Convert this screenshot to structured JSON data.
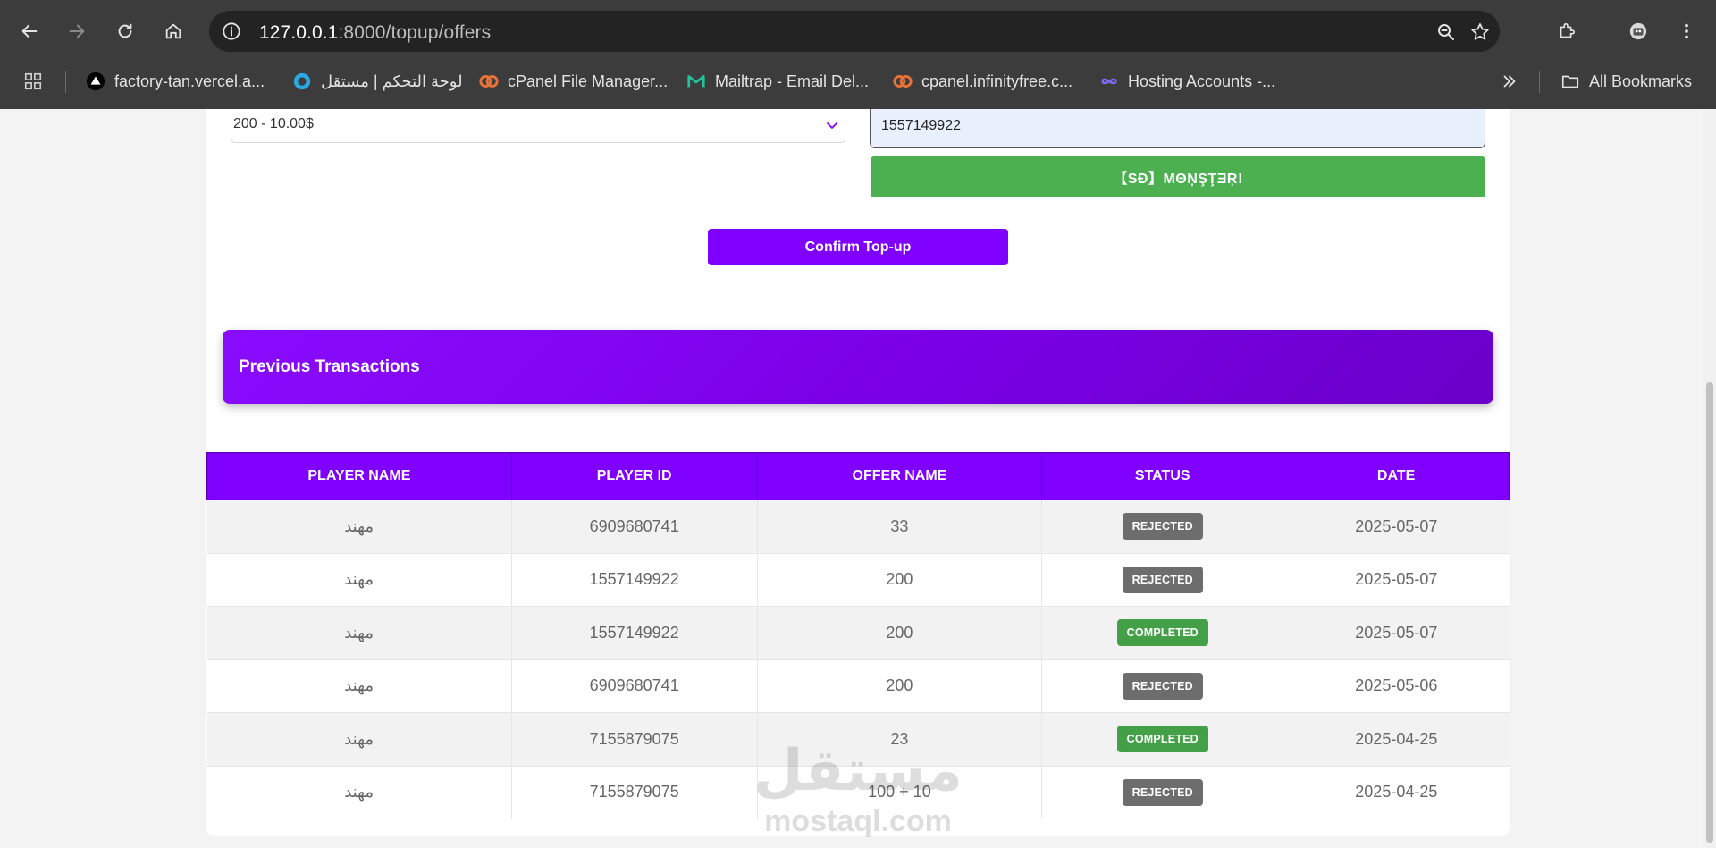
{
  "browser": {
    "url_host": "127.0.0.1",
    "url_rest": ":8000/topup/offers",
    "bookmarks": [
      {
        "label": "factory-tan.vercel.a...",
        "icon": "vercel-icon"
      },
      {
        "label": "لوحة التحكم | مستقل",
        "icon": "mostaql-icon"
      },
      {
        "label": "cPanel File Manager...",
        "icon": "cpanel-icon"
      },
      {
        "label": "Mailtrap - Email Del...",
        "icon": "mailtrap-icon"
      },
      {
        "label": "cpanel.infinityfree.c...",
        "icon": "cpanel-icon"
      },
      {
        "label": "Hosting Accounts -...",
        "icon": "infinityfree-icon"
      }
    ],
    "all_bookmarks_label": "All Bookmarks"
  },
  "form": {
    "offer_select_value": "200 - 10.00$",
    "player_id_value": "1557149922",
    "player_nickname": "【SĐ】MΘŅŞŢƎŖ!",
    "confirm_label": "Confirm Top-up"
  },
  "transactions": {
    "title": "Previous Transactions",
    "columns": [
      "PLAYER NAME",
      "PLAYER ID",
      "OFFER NAME",
      "STATUS",
      "DATE"
    ],
    "rows": [
      {
        "player_name": "مهند",
        "player_id": "6909680741",
        "offer_name": "33",
        "status": "REJECTED",
        "date": "2025-05-07"
      },
      {
        "player_name": "مهند",
        "player_id": "1557149922",
        "offer_name": "200",
        "status": "REJECTED",
        "date": "2025-05-07"
      },
      {
        "player_name": "مهند",
        "player_id": "1557149922",
        "offer_name": "200",
        "status": "COMPLETED",
        "date": "2025-05-07"
      },
      {
        "player_name": "مهند",
        "player_id": "6909680741",
        "offer_name": "200",
        "status": "REJECTED",
        "date": "2025-05-06"
      },
      {
        "player_name": "مهند",
        "player_id": "7155879075",
        "offer_name": "23",
        "status": "COMPLETED",
        "date": "2025-04-25"
      },
      {
        "player_name": "مهند",
        "player_id": "7155879075",
        "offer_name": "100 + 10",
        "status": "REJECTED",
        "date": "2025-04-25"
      }
    ]
  },
  "watermark": {
    "arabic": "مستقل",
    "latin": "mostaql.com"
  },
  "colors": {
    "accent": "#8000ff",
    "success": "#43a047",
    "rejected": "#6d6d6d",
    "nickname_button": "#4caf50"
  }
}
